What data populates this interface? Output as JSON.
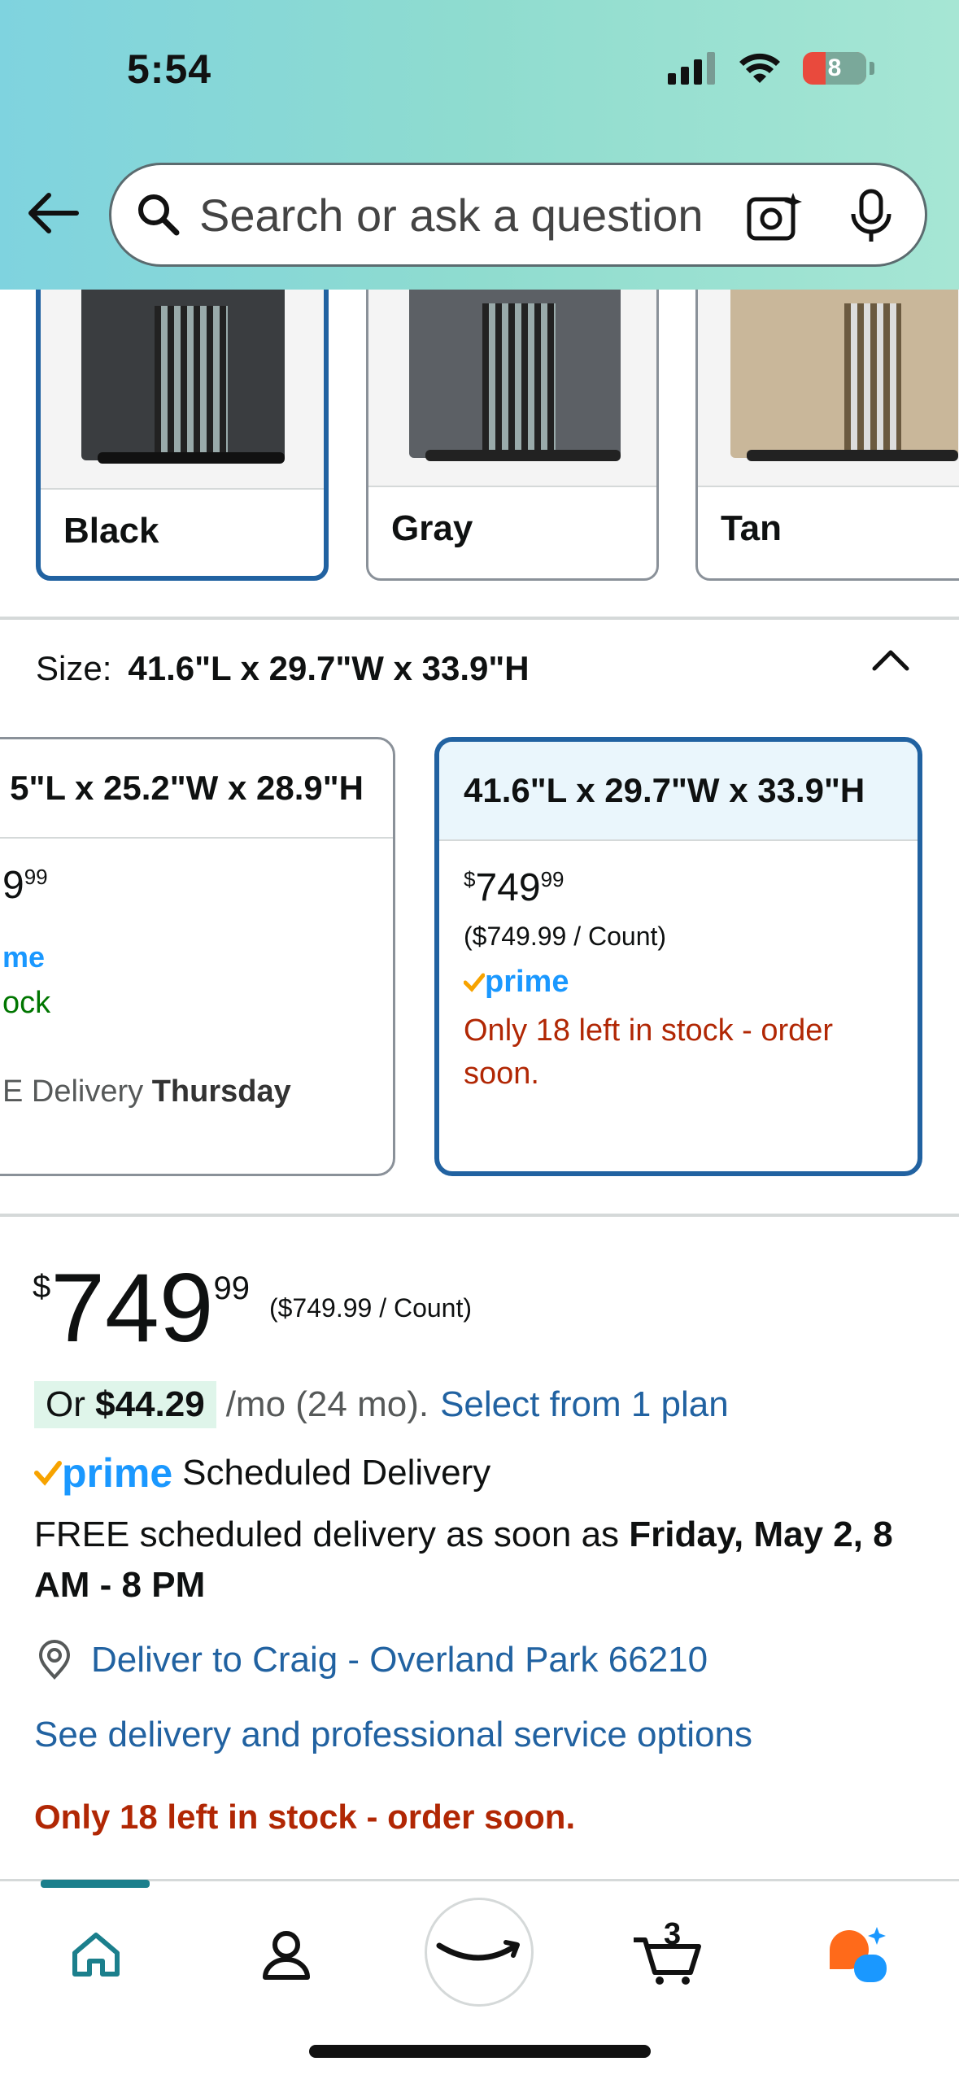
{
  "status_bar": {
    "time": "5:54",
    "battery": "8"
  },
  "search": {
    "placeholder": "Search or ask a question"
  },
  "colors": [
    {
      "label": "Black",
      "selected": true,
      "tint": "#3a3d40"
    },
    {
      "label": "Gray",
      "selected": false,
      "tint": "#5c6065"
    },
    {
      "label": "Tan",
      "selected": false,
      "tint": "#c9b79a"
    }
  ],
  "size": {
    "key": "Size:",
    "value": "41.6\"L x 29.7\"W x 33.9\"H",
    "options": [
      {
        "title": "5\"L x 25.2\"W x 28.9\"H",
        "price_whole": "9",
        "price_frac": "99",
        "prime": "me",
        "stock": "ock",
        "delivery_pre": "E Delivery ",
        "delivery_day": "Thursday"
      },
      {
        "title": "41.6\"L x 29.7\"W x 33.9\"H",
        "price_symbol": "$",
        "price_whole": "749",
        "price_frac": "99",
        "unit": "($749.99 / Count)",
        "prime": "prime",
        "stock": "Only 18 left in stock - order soon."
      }
    ]
  },
  "price": {
    "symbol": "$",
    "whole": "749",
    "frac": "99",
    "unit": "($749.99 / Count)"
  },
  "plan": {
    "or": "Or ",
    "amount": "$44.29",
    "per": "/mo (24 mo).",
    "link": "Select from 1 plan"
  },
  "schedule": {
    "prime": "prime",
    "label": "Scheduled Delivery",
    "line_pre": "FREE scheduled delivery as soon as ",
    "line_bold": "Friday, May 2, 8 AM - 8 PM"
  },
  "deliver_to": "Deliver to Craig - Overland Park 66210",
  "see_options": "See delivery and professional service options",
  "only_left": "Only 18 left in stock - order soon.",
  "cart_count": "3",
  "accent": {
    "link": "#2162a1",
    "red": "#b12704",
    "prime": "#1a98ff",
    "teal": "#1b7f8c"
  }
}
